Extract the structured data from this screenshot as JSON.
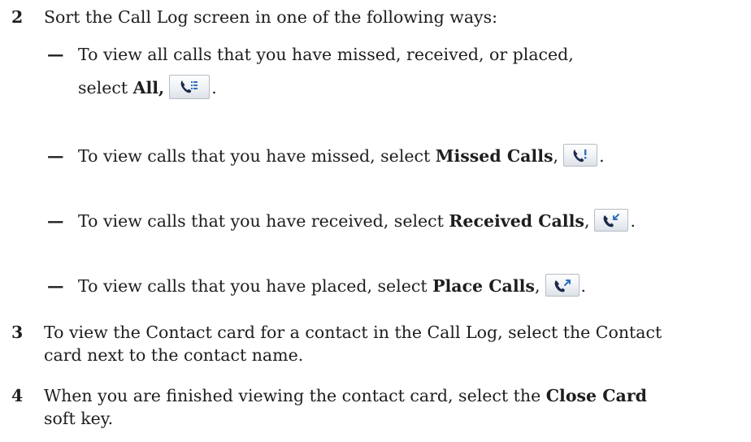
{
  "step2": {
    "number": "2",
    "text": "Sort the Call Log screen in one of the following ways:"
  },
  "options": [
    {
      "dash": "—",
      "line1": "To view all calls that you have missed, received, or placed,",
      "line2_prefix": "select ",
      "bold": "All,",
      "icon": "all-calls-icon",
      "end": "."
    },
    {
      "dash": "—",
      "prefix": "To view calls that you have missed, select ",
      "bold": "Missed Calls",
      "comma": ",",
      "icon": "missed-calls-icon",
      "end": "."
    },
    {
      "dash": "—",
      "prefix": "To view calls that you have received, select ",
      "bold": "Received Calls",
      "comma": ",",
      "icon": "received-calls-icon",
      "end": "."
    },
    {
      "dash": "—",
      "prefix": "To view calls that you have placed, select ",
      "bold": "Place Calls",
      "comma": ",",
      "icon": "placed-calls-icon",
      "end": "."
    }
  ],
  "step3": {
    "number": "3",
    "line1": "To view the Contact card for a contact in the Call Log, select the Contact",
    "line2": "card next to the contact name."
  },
  "step4": {
    "number": "4",
    "line1_prefix": "When you are finished viewing the contact card, select the ",
    "line1_bold": "Close Card",
    "line2": "soft key."
  },
  "colors": {
    "text": "#1e1e1e",
    "icon": "#1a2a4a",
    "icon_accent": "#2f6fbf"
  }
}
